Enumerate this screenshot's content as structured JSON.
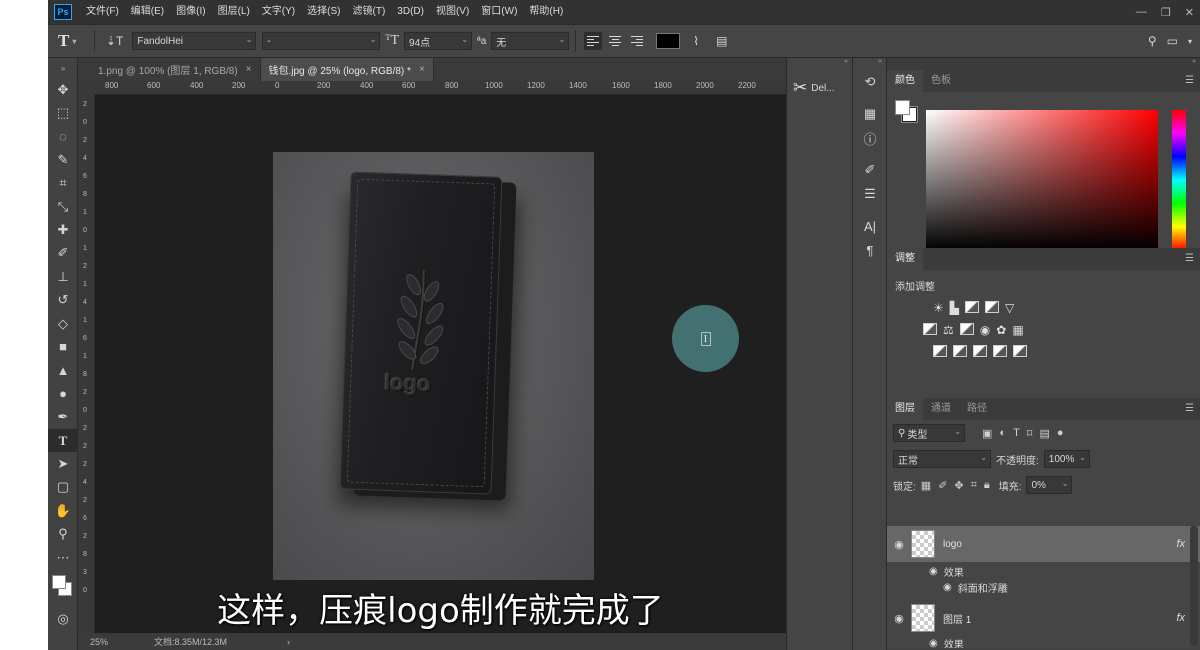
{
  "menubar": {
    "logo": "Ps",
    "items": [
      "文件(F)",
      "编辑(E)",
      "图像(I)",
      "图层(L)",
      "文字(Y)",
      "选择(S)",
      "滤镜(T)",
      "3D(D)",
      "视图(V)",
      "窗口(W)",
      "帮助(H)"
    ]
  },
  "options": {
    "tool_glyph": "T",
    "font_family": "FandolHei",
    "font_style": "-",
    "font_size": "94点",
    "aa_label": "ªa",
    "aa_mode": "无"
  },
  "tabs": [
    {
      "label": "1.png @ 100% (图层 1, RGB/8)",
      "close": "×"
    },
    {
      "label": "钱包.jpg @ 25% (logo, RGB/8) *",
      "close": "×"
    }
  ],
  "ruler": {
    "ticks": [
      "800",
      "600",
      "400",
      "200",
      "0",
      "200",
      "400",
      "600",
      "800",
      "1000",
      "1200",
      "1400",
      "1600",
      "1800",
      "2000",
      "2200"
    ],
    "left_ticks": [
      "2",
      "0",
      "2",
      "4",
      "6",
      "8",
      "1",
      "0",
      "1",
      "2",
      "1",
      "4",
      "1",
      "6",
      "1",
      "8",
      "2",
      "0",
      "2",
      "2",
      "2",
      "4",
      "2",
      "6",
      "2",
      "8",
      "3",
      "0"
    ]
  },
  "canvas": {
    "emboss_text": "logo",
    "subtitle": "这样，压痕logo制作就完成了"
  },
  "status": {
    "zoom": "25%",
    "doc": "文档:8.35M/12.3M",
    "arrow": "›"
  },
  "panel_strip": {
    "tool_label": "Del..."
  },
  "color_panel": {
    "tabs": [
      "颜色",
      "色板"
    ],
    "fg": "#ffffff",
    "bg": "#ffffff"
  },
  "adjust_panel": {
    "tab": "调整",
    "title": "添加调整"
  },
  "layers_panel": {
    "tabs": [
      "图层",
      "通道",
      "路径"
    ],
    "filter_kind": "类型",
    "blend_mode": "正常",
    "opacity_label": "不透明度:",
    "opacity_value": "100%",
    "lock_label": "锁定:",
    "fill_label": "填充:",
    "fill_value": "0%",
    "layers": [
      {
        "name": "logo",
        "fx": "fx",
        "effects_label": "效果",
        "effect": "斜面和浮雕"
      },
      {
        "name": "图层 1",
        "fx": "fx",
        "effects_label": "效果"
      }
    ]
  }
}
